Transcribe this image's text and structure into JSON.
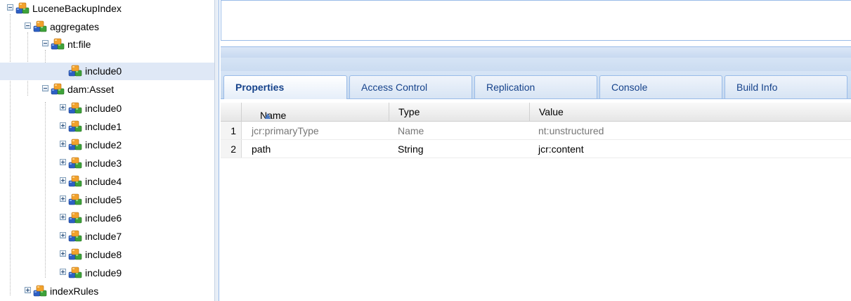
{
  "tree": {
    "items": [
      {
        "label": "LuceneBackupIndex",
        "state": "expanded",
        "selected": false
      },
      {
        "label": "aggregates",
        "state": "expanded",
        "selected": false
      },
      {
        "label": "nt:file",
        "state": "expanded",
        "selected": false
      },
      {
        "label": "include0",
        "state": "leaf",
        "selected": true
      },
      {
        "label": "dam:Asset",
        "state": "expanded",
        "selected": false
      },
      {
        "label": "include0",
        "state": "collapsed",
        "selected": false
      },
      {
        "label": "include1",
        "state": "collapsed",
        "selected": false
      },
      {
        "label": "include2",
        "state": "collapsed",
        "selected": false
      },
      {
        "label": "include3",
        "state": "collapsed",
        "selected": false
      },
      {
        "label": "include4",
        "state": "collapsed",
        "selected": false
      },
      {
        "label": "include5",
        "state": "collapsed",
        "selected": false
      },
      {
        "label": "include6",
        "state": "collapsed",
        "selected": false
      },
      {
        "label": "include7",
        "state": "collapsed",
        "selected": false
      },
      {
        "label": "include8",
        "state": "collapsed",
        "selected": false
      },
      {
        "label": "include9",
        "state": "collapsed",
        "selected": false
      },
      {
        "label": "indexRules",
        "state": "collapsed",
        "selected": false
      }
    ]
  },
  "tabs": [
    {
      "label": "Properties",
      "active": true
    },
    {
      "label": "Access Control",
      "active": false
    },
    {
      "label": "Replication",
      "active": false
    },
    {
      "label": "Console",
      "active": false
    },
    {
      "label": "Build Info",
      "active": false
    }
  ],
  "grid": {
    "columns": [
      "Name",
      "Type",
      "Value"
    ],
    "sort_indicator": "▲",
    "rows": [
      {
        "num": "1",
        "name": "jcr:primaryType",
        "type": "Name",
        "value": "nt:unstructured",
        "muted": true
      },
      {
        "num": "2",
        "name": "path",
        "type": "String",
        "value": "jcr:content",
        "muted": false
      }
    ]
  },
  "colors": {
    "panel_border": "#99bbe8",
    "tab_text": "#15428b",
    "selection": "#dfe8f6"
  }
}
